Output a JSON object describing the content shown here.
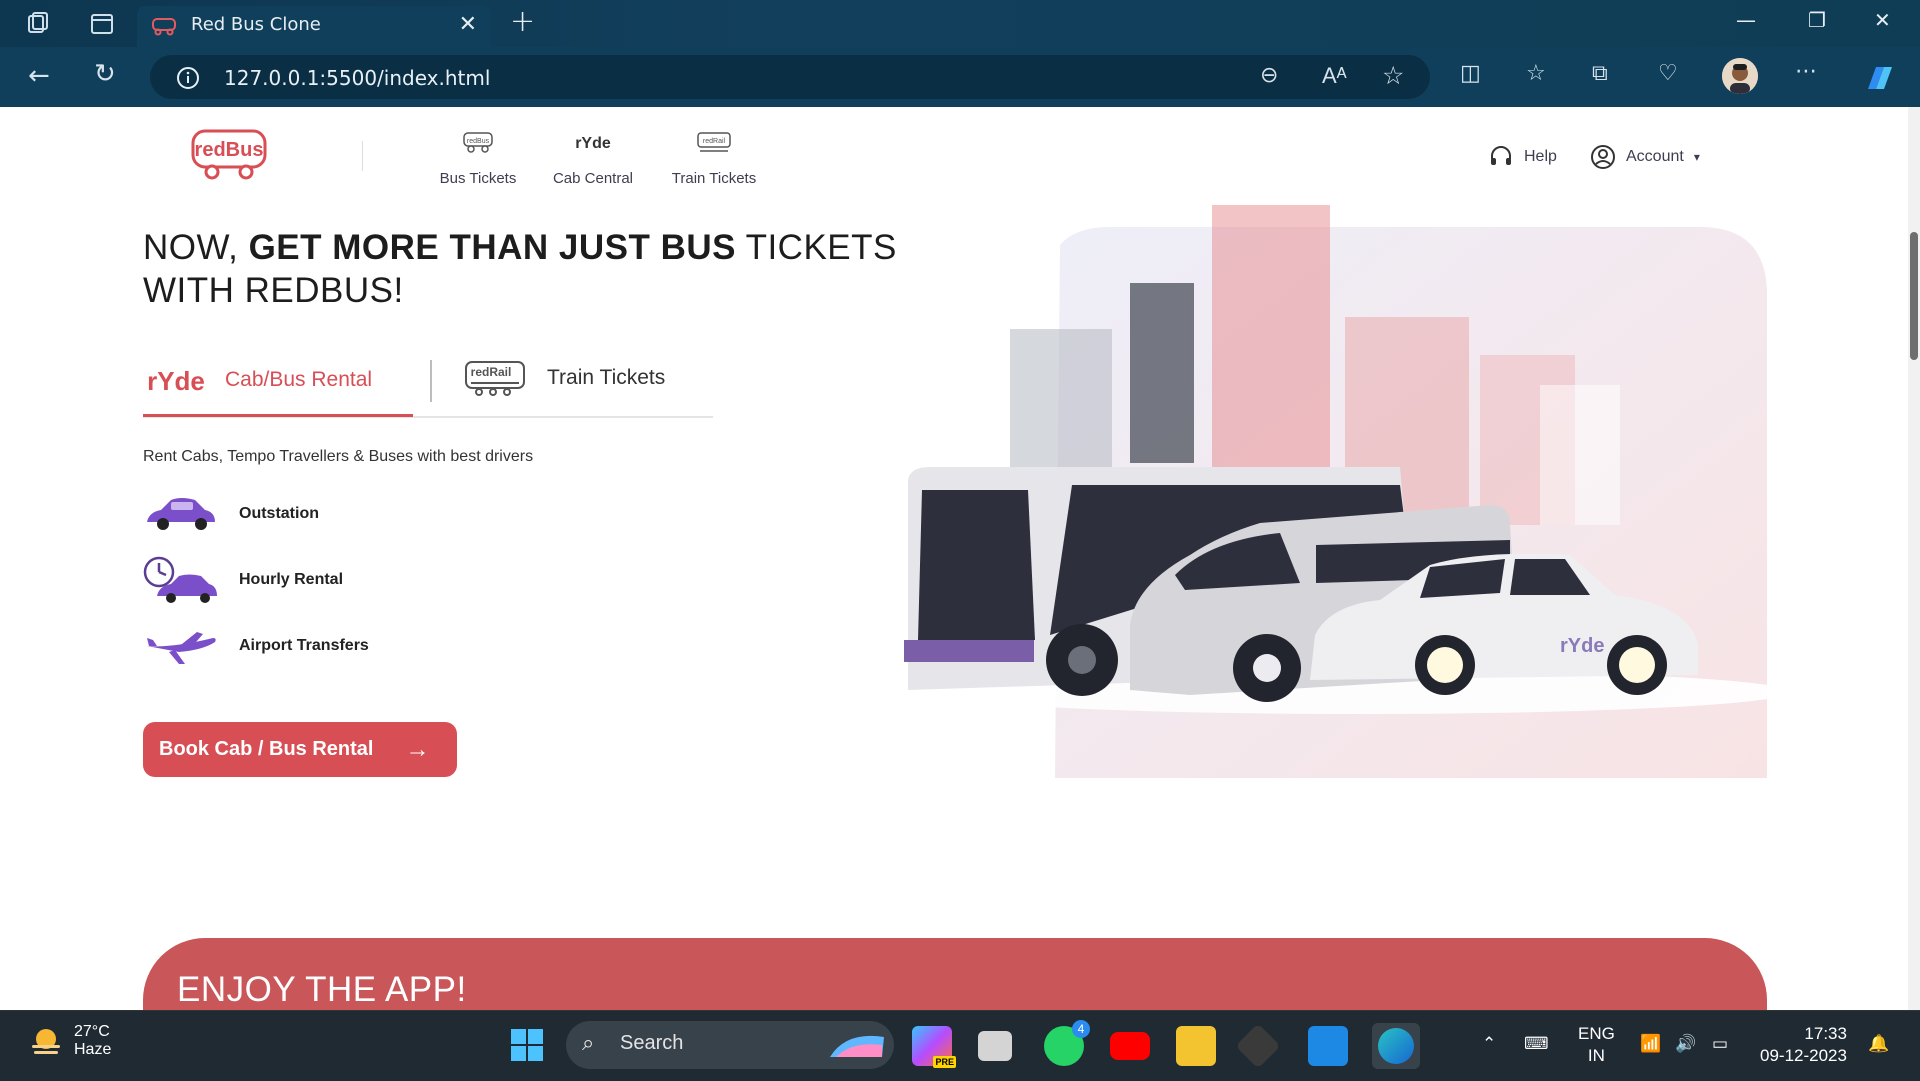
{
  "browser": {
    "tab_title": "Red Bus Clone",
    "url": "127.0.0.1:5500/index.html",
    "icons": [
      "workspaces-icon",
      "tab-actions-icon",
      "back-icon",
      "refresh-icon",
      "info-icon",
      "zoom-out-icon",
      "read-aloud-icon",
      "favorite-icon",
      "split-screen-icon",
      "favorites-icon",
      "collections-icon",
      "performance-icon",
      "profile-avatar",
      "more-icon",
      "copilot-icon"
    ]
  },
  "nav": {
    "logo_text": "redBus",
    "items": [
      {
        "label": "Bus Tickets",
        "icon_text": "redBus"
      },
      {
        "label": "Cab Central",
        "icon_text": "rYde"
      },
      {
        "label": "Train Tickets",
        "icon_text": "redRail"
      }
    ],
    "help": "Help",
    "account": "Account"
  },
  "hero": {
    "headline_1": "NOW,",
    "headline_2": "GET MORE THAN JUST BUS",
    "headline_3": "TICKETS",
    "headline_4": "WITH REDBUS!",
    "tab_cab_logo": "rYde",
    "tab_cab": "Cab/Bus Rental",
    "tab_train_logo": "redRail",
    "tab_train": "Train Tickets",
    "subtitle": "Rent Cabs, Tempo Travellers & Buses with best drivers",
    "features": [
      "Outstation",
      "Hourly Rental",
      "Airport Transfers"
    ],
    "cta": "Book Cab / Bus Rental",
    "car_brand": "rYde"
  },
  "app_section": {
    "title": "ENJOY THE APP!"
  },
  "taskbar": {
    "temperature": "27°C",
    "condition": "Haze",
    "search": "Search",
    "whatsapp_badge": "4",
    "lang_1": "ENG",
    "lang_2": "IN",
    "time": "17:33",
    "date": "09-12-2023",
    "pre_badge": "PRE"
  },
  "colors": {
    "brand_red": "#d84e55",
    "banner_red": "#c95659",
    "purple": "#7b4fc9"
  }
}
